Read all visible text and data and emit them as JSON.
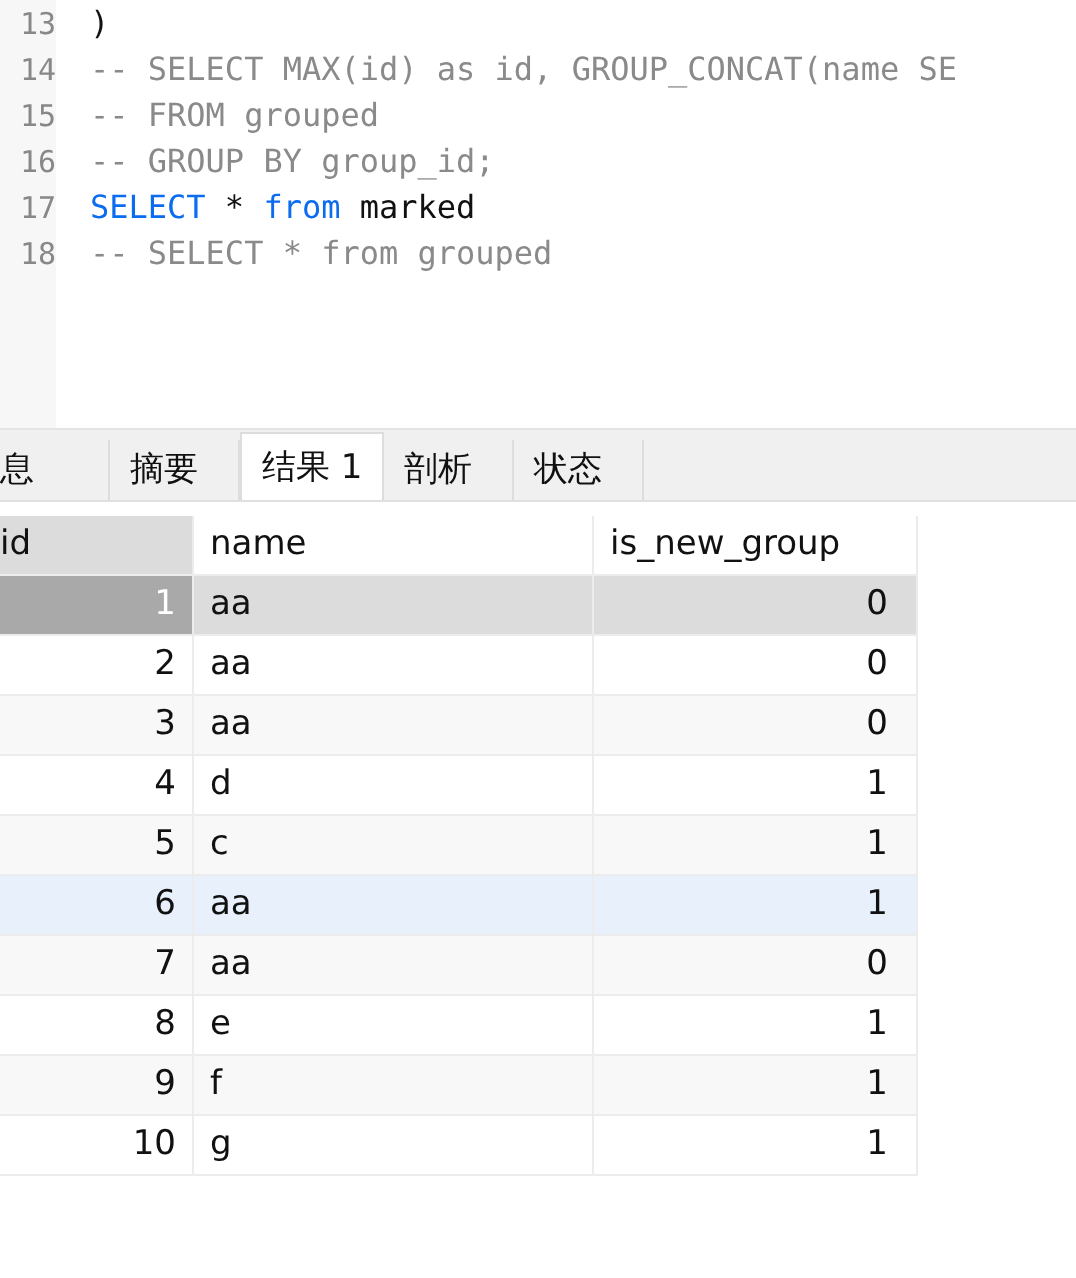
{
  "editor": {
    "lines": [
      {
        "number": "13",
        "tokens": [
          {
            "kind": "plain",
            "text": ")"
          }
        ]
      },
      {
        "number": "14",
        "tokens": [
          {
            "kind": "comment",
            "text": "-- SELECT MAX(id) as id, GROUP_CONCAT(name SE"
          }
        ]
      },
      {
        "number": "15",
        "tokens": [
          {
            "kind": "comment",
            "text": "-- FROM grouped"
          }
        ]
      },
      {
        "number": "16",
        "tokens": [
          {
            "kind": "comment",
            "text": "-- GROUP BY group_id;"
          }
        ]
      },
      {
        "number": "17",
        "tokens": [
          {
            "kind": "keyword",
            "text": "SELECT"
          },
          {
            "kind": "plain",
            "text": " * "
          },
          {
            "kind": "keyword",
            "text": "from"
          },
          {
            "kind": "plain",
            "text": " marked"
          }
        ]
      },
      {
        "number": "18",
        "tokens": [
          {
            "kind": "comment",
            "text": "-- SELECT * from grouped"
          }
        ]
      }
    ]
  },
  "tabs": [
    {
      "label": "息",
      "selected": false
    },
    {
      "label": "摘要",
      "selected": false
    },
    {
      "label": "结果 1",
      "selected": true
    },
    {
      "label": "剖析",
      "selected": false
    },
    {
      "label": "状态",
      "selected": false
    }
  ],
  "table": {
    "columns": [
      "id",
      "name",
      "is_new_group"
    ],
    "rows": [
      {
        "cells": [
          "1",
          "aa",
          "0"
        ],
        "selected": true,
        "hovered": false
      },
      {
        "cells": [
          "2",
          "aa",
          "0"
        ],
        "selected": false,
        "hovered": false
      },
      {
        "cells": [
          "3",
          "aa",
          "0"
        ],
        "selected": false,
        "hovered": false
      },
      {
        "cells": [
          "4",
          "d",
          "1"
        ],
        "selected": false,
        "hovered": false
      },
      {
        "cells": [
          "5",
          "c",
          "1"
        ],
        "selected": false,
        "hovered": false
      },
      {
        "cells": [
          "6",
          "aa",
          "1"
        ],
        "selected": false,
        "hovered": true
      },
      {
        "cells": [
          "7",
          "aa",
          "0"
        ],
        "selected": false,
        "hovered": false
      },
      {
        "cells": [
          "8",
          "e",
          "1"
        ],
        "selected": false,
        "hovered": false
      },
      {
        "cells": [
          "9",
          "f",
          "1"
        ],
        "selected": false,
        "hovered": false
      },
      {
        "cells": [
          "10",
          "g",
          "1"
        ],
        "selected": false,
        "hovered": false
      }
    ]
  }
}
